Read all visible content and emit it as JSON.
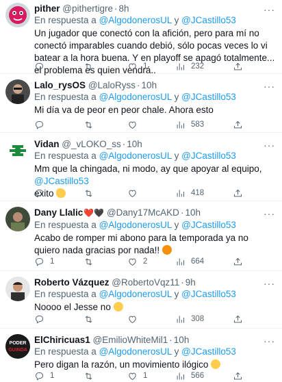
{
  "reply_prefix": "En respuesta a",
  "reply_mention_1": "@AlgodonerosUL",
  "reply_joiner": "y",
  "reply_mention_2": "@JCastillo53",
  "more_glyph": "···",
  "colors": {
    "accent": "#1d9bf0",
    "muted": "#536471",
    "text": "#0f1419",
    "divider": "#eff3f4"
  },
  "tweets": [
    {
      "name": "pither",
      "handle": "@pithertigre",
      "time": "8h",
      "text": "Un jugador que conectó con la afición, pero para mí no conectó imparables cuando debió, sólo pocas veces lo vi batear a la hora buena. Y en playoff se apagó totalmente... el problema es quien vendrá..",
      "replies": "",
      "retweets": "",
      "likes": "1",
      "views": "232"
    },
    {
      "name": "Lalo_rysOS",
      "handle": "@LaloRyss",
      "time": "10h",
      "text": "Mi día va de peor en peor chale. Ahora esto",
      "replies": "",
      "retweets": "",
      "likes": "",
      "views": "583"
    },
    {
      "name": "Vidan",
      "handle": "@_vLOKO_ss",
      "time": "10h",
      "text_a": "Mm que la chingada, ni modo, ay que apoyar al equipo,",
      "text_mention": "@JCastillo53",
      "text_b": "exito",
      "replies": "",
      "retweets": "",
      "likes": "",
      "views": "418"
    },
    {
      "name": "Dany Llalic",
      "name_hearts": "❤️🖤",
      "handle": "@Dany17McAKD",
      "time": "10h",
      "text": "Acabo de romper mi abono para la temporada ya no quiero nada gracias por nada!!",
      "replies": "1",
      "retweets": "",
      "likes": "2",
      "views": "664"
    },
    {
      "name": "Roberto Vázquez",
      "handle": "@RobertoVqz11",
      "time": "9h",
      "text": "Noooo el Jesse no",
      "replies": "",
      "retweets": "",
      "likes": "",
      "views": "308"
    },
    {
      "name": "ElChiricuas1",
      "handle": "@EmilioWhiteMil1",
      "time": "10h",
      "text": "Pero digan la razón, un movimiento ilógico",
      "replies": "1",
      "retweets": "",
      "likes": "1",
      "views": "566",
      "avatar_text_1": "PODER",
      "avatar_text_2": "GUINDA"
    }
  ]
}
